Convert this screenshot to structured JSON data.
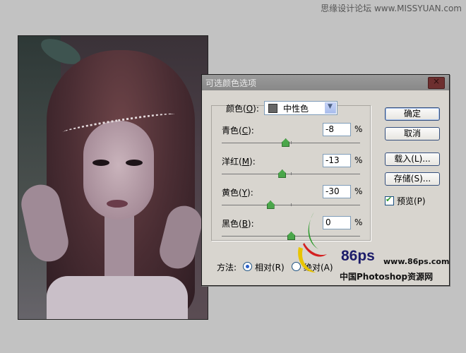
{
  "watermark_top": "思缘设计论坛 www.MISSYUAN.com",
  "dialog": {
    "title": "可选颜色选项",
    "color_label": "颜色(",
    "color_key": "O",
    "color_label_end": "):",
    "color_select": "中性色",
    "sliders": [
      {
        "label": "青色(",
        "key": "C",
        "end": "):",
        "value": "-8",
        "unit": "%",
        "level": -8
      },
      {
        "label": "洋红(",
        "key": "M",
        "end": "):",
        "value": "-13",
        "unit": "%",
        "level": -13
      },
      {
        "label": "黄色(",
        "key": "Y",
        "end": "):",
        "value": "-30",
        "unit": "%",
        "level": -30
      },
      {
        "label": "黑色(",
        "key": "B",
        "end": "):",
        "value": "0",
        "unit": "%",
        "level": 0
      }
    ],
    "buttons": {
      "ok": "确定",
      "cancel": "取消",
      "load": "载入(L)...",
      "save": "存储(S)..."
    },
    "preview_label": "预览(P)",
    "preview_checked": true,
    "method_label": "方法:",
    "method_relative": "相对(R)",
    "method_absolute": "绝对(A)",
    "method_selected": "relative"
  },
  "logo": {
    "number": "86ps",
    "url": "www.86ps.com",
    "name": "中国Photoshop资源网"
  }
}
